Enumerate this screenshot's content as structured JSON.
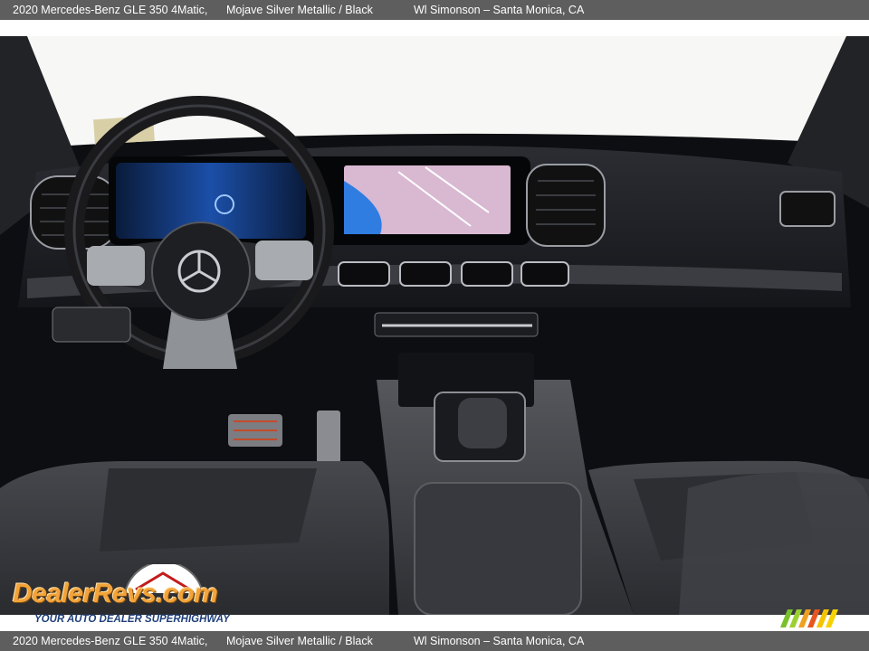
{
  "caption": {
    "title": "2020 Mercedes-Benz GLE 350 4Matic,",
    "color": "Mojave Silver Metallic / Black",
    "dealer": "Wl Simonson – Santa Monica, CA"
  },
  "watermark": {
    "brand": "DealerRevs.com",
    "tagline": "YOUR AUTO DEALER SUPERHIGHWAY"
  },
  "photo": {
    "subject": "car-interior-dashboard",
    "colors": {
      "cabin": "#0d0e11",
      "windshield": "#f7f7f5",
      "screen_blue": "#2f7de1",
      "map": "#d9b8d2",
      "leather": "#3b3d42"
    }
  }
}
